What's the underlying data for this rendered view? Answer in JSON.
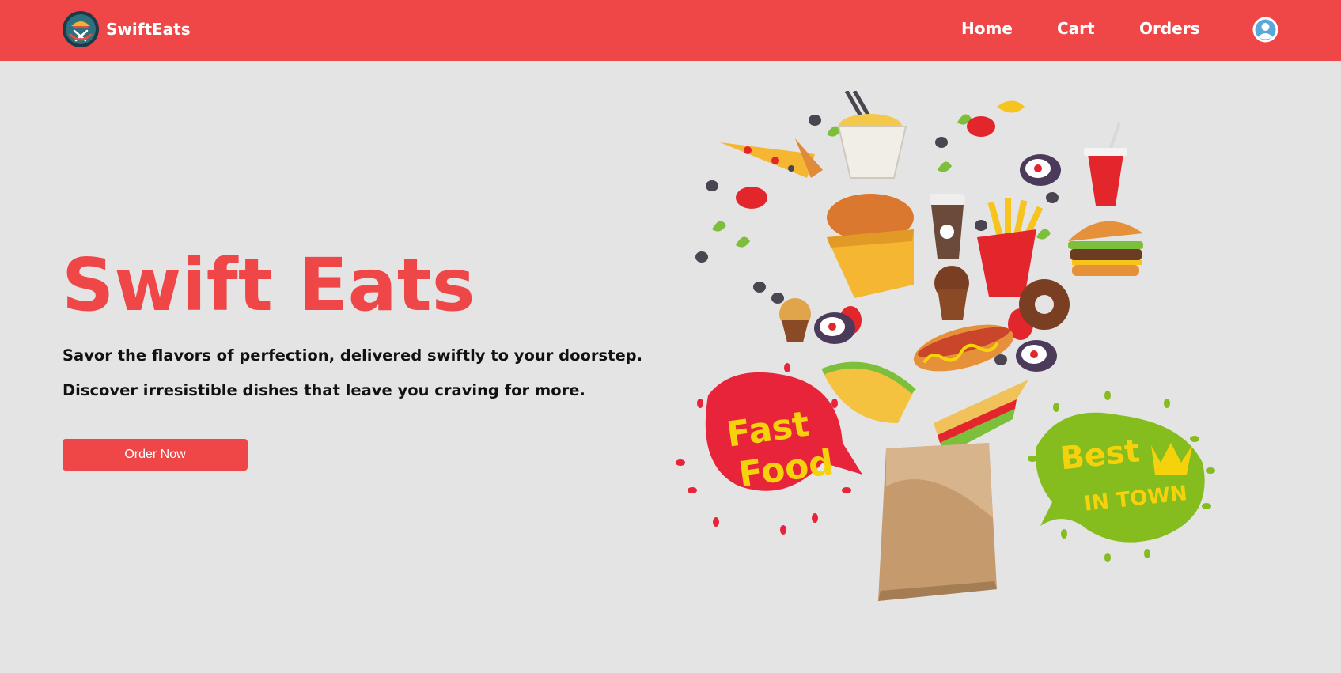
{
  "navbar": {
    "brand": "SwiftEats",
    "links": [
      {
        "label": "Home"
      },
      {
        "label": "Cart"
      },
      {
        "label": "Orders"
      }
    ],
    "icons": {
      "logo": "food-logo-icon",
      "account": "user-avatar-icon"
    }
  },
  "hero": {
    "title": "Swift Eats",
    "tagline_1": "Savor the flavors of perfection, delivered swiftly to your doorstep.",
    "tagline_2": "Discover irresistible dishes that leave you craving for more.",
    "cta_label": "Order Now"
  },
  "illustration": {
    "badge_left": {
      "line_1": "Fast",
      "line_2": "Food"
    },
    "badge_right": {
      "line_1": "Best",
      "line_2": "IN TOWN"
    }
  },
  "colors": {
    "brand": "#ef4647",
    "background": "#e4e4e4",
    "text": "#111111",
    "badge_green": "#84bd1d",
    "badge_text": "#f6d20d"
  }
}
